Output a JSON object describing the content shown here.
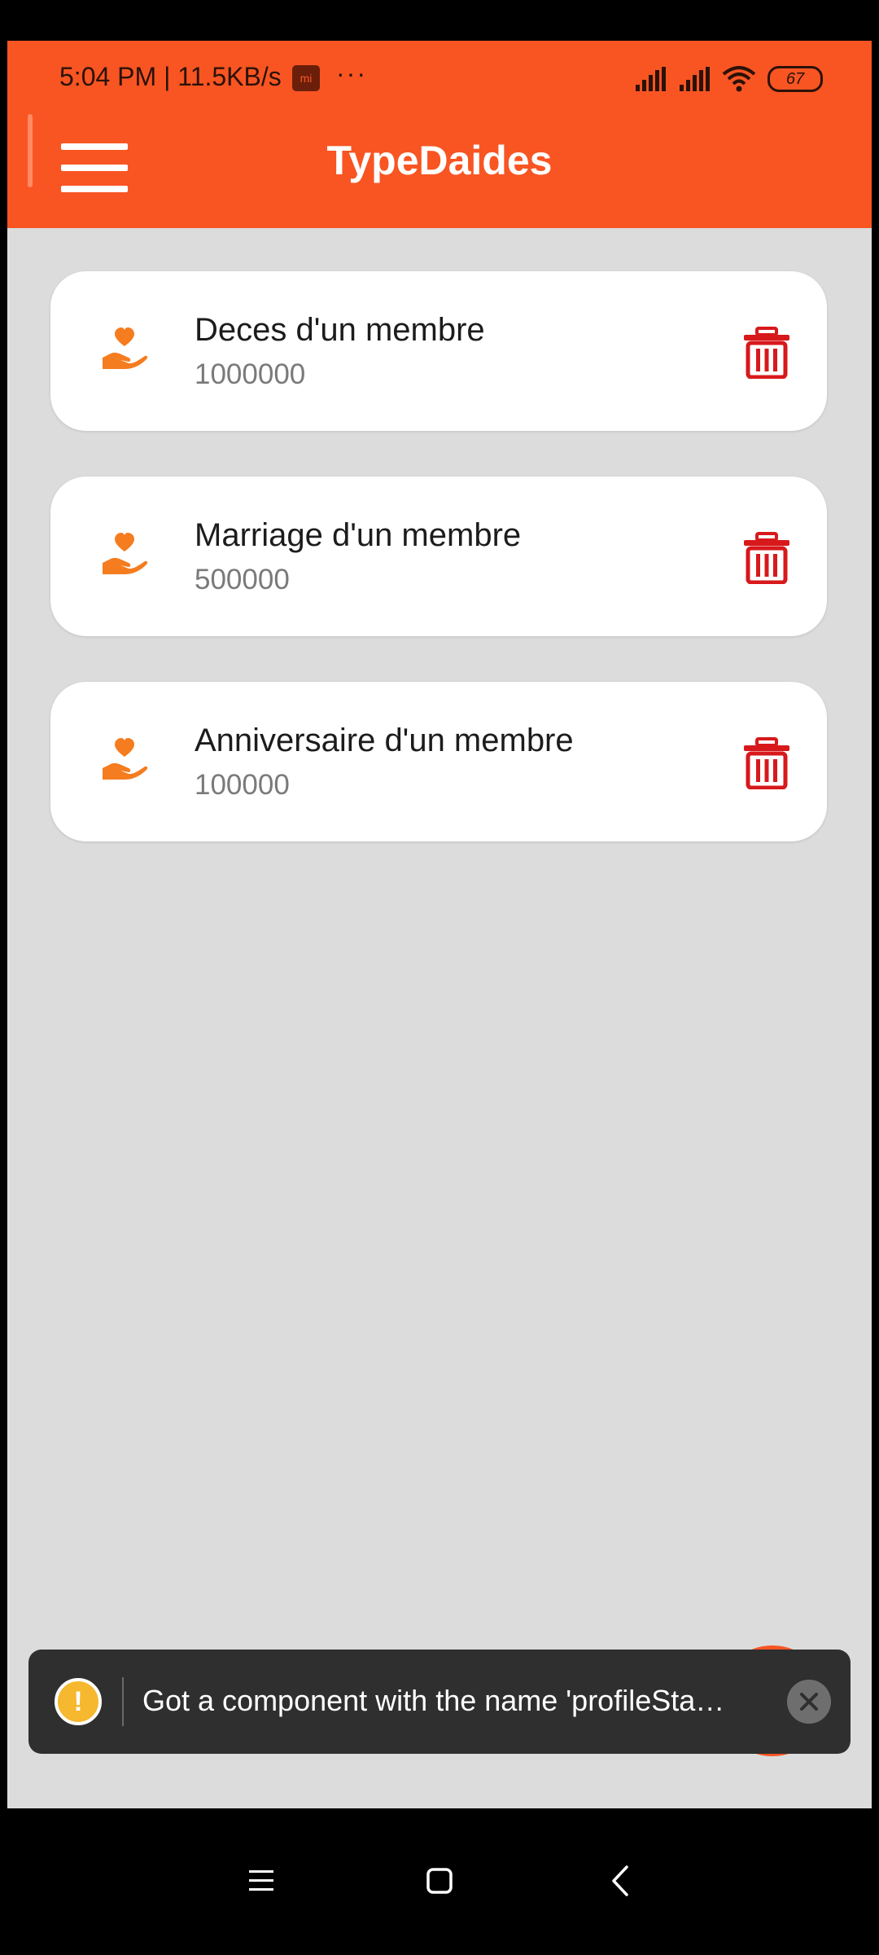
{
  "status_bar": {
    "time_speed": "5:04 PM | 11.5KB/s",
    "app_badge": "mi",
    "overflow": "···",
    "battery": "67",
    "icons": [
      "signal-icon",
      "signal-icon",
      "wifi-icon",
      "battery-icon"
    ]
  },
  "app_bar": {
    "title": "TypeDaides",
    "menu_icon": "hamburger-menu-icon"
  },
  "colors": {
    "primary": "#f85523",
    "accent_icon": "#f57c1f",
    "delete": "#d7191c",
    "background": "#dcdcdc"
  },
  "items": [
    {
      "title": "Deces d'un membre",
      "amount": "1000000",
      "icon": "hand-heart-icon",
      "action_icon": "trash-icon"
    },
    {
      "title": "Marriage d'un membre",
      "amount": "500000",
      "icon": "hand-heart-icon",
      "action_icon": "trash-icon"
    },
    {
      "title": "Anniversaire d'un membre",
      "amount": "100000",
      "icon": "hand-heart-icon",
      "action_icon": "trash-icon"
    }
  ],
  "toast": {
    "icon": "warning-icon",
    "message": "Got a component with the name 'profileSta…",
    "close_icon": "close-icon"
  },
  "nav_bar": {
    "buttons": [
      "recents-menu-icon",
      "home-square-icon",
      "back-chevron-icon"
    ]
  }
}
